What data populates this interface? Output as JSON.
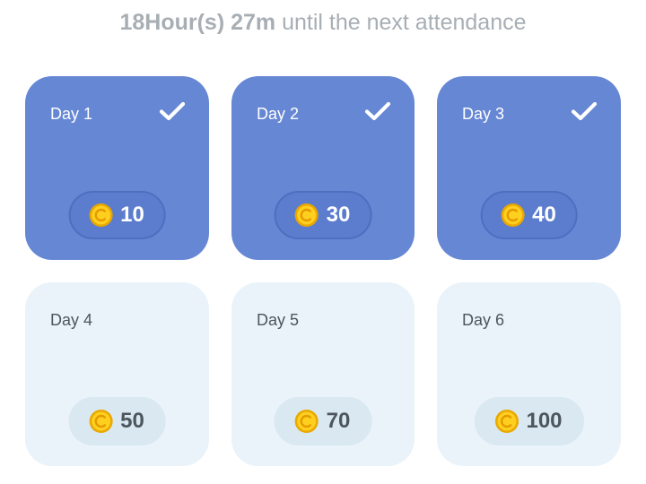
{
  "header": {
    "countdown_time": "18Hour(s) 27m",
    "countdown_suffix": " until the next attendance"
  },
  "colors": {
    "claimed_card": "#6687d4",
    "pending_card": "#e9f3f9",
    "coin_gold": "#f5c518",
    "countdown_text": "#a7aeb4"
  },
  "days": [
    {
      "label": "Day 1",
      "reward": "10",
      "claimed": true
    },
    {
      "label": "Day 2",
      "reward": "30",
      "claimed": true
    },
    {
      "label": "Day 3",
      "reward": "40",
      "claimed": true
    },
    {
      "label": "Day 4",
      "reward": "50",
      "claimed": false
    },
    {
      "label": "Day 5",
      "reward": "70",
      "claimed": false
    },
    {
      "label": "Day 6",
      "reward": "100",
      "claimed": false
    }
  ],
  "icons": {
    "check": "checkmark-icon",
    "coin": "coin-icon"
  }
}
